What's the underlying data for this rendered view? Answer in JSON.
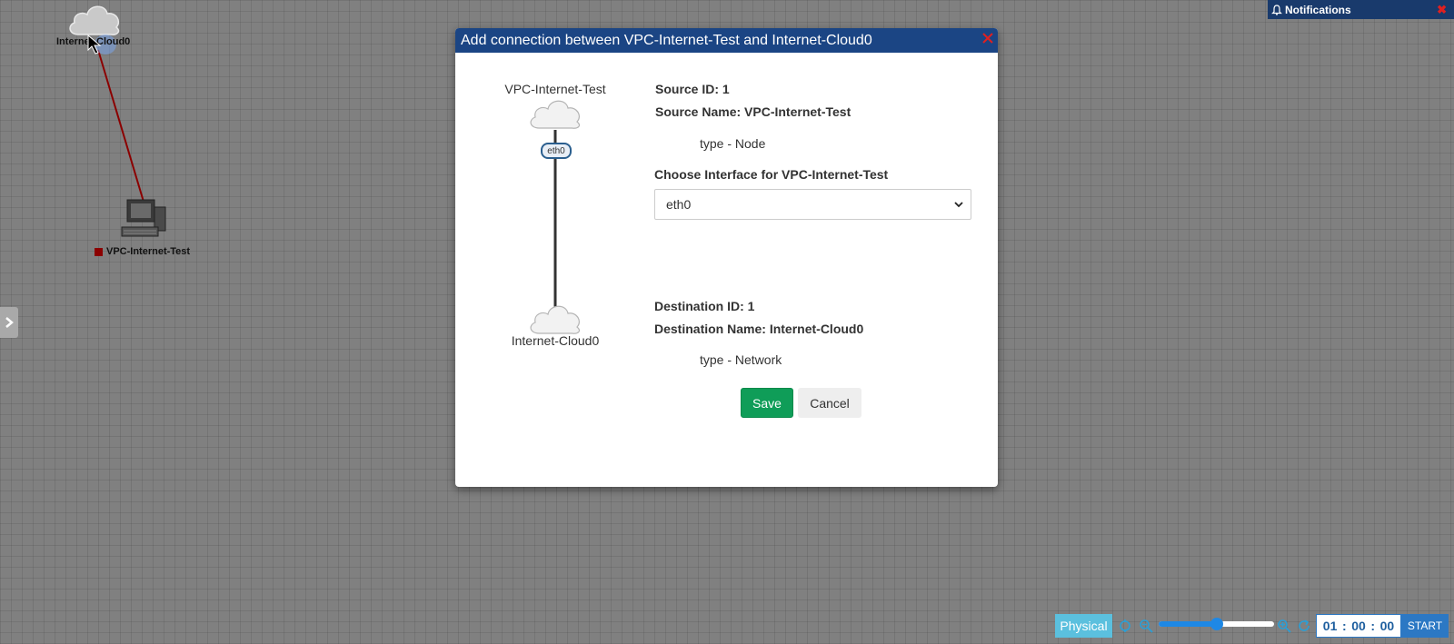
{
  "canvas": {
    "nodes": [
      {
        "label": "Internet-Cloud0",
        "icon": "cloud-icon"
      },
      {
        "label": "VPC-Internet-Test",
        "icon": "computer-icon",
        "status_color": "#8b0000"
      }
    ],
    "link_color": "#8b0000"
  },
  "notifications": {
    "title": "Notifications",
    "close_icon": "close-icon"
  },
  "modal": {
    "title": "Add connection between VPC-Internet-Test and Internet-Cloud0",
    "diagram": {
      "source_label": "VPC-Internet-Test",
      "interface_tag": "eth0",
      "destination_label": "Internet-Cloud0"
    },
    "source": {
      "id_label": "Source ID:",
      "id_value": "1",
      "name_label": "Source Name:",
      "name_value": "VPC-Internet-Test",
      "type_text": "type - Node",
      "interface_label": "Choose Interface for VPC-Internet-Test",
      "interface_selected": "eth0"
    },
    "destination": {
      "id_label": "Destination ID:",
      "id_value": "1",
      "name_label": "Destination Name:",
      "name_value": "Internet-Cloud0",
      "type_text": "type - Network"
    },
    "save_label": "Save",
    "cancel_label": "Cancel"
  },
  "toolbar": {
    "physical_label": "Physical",
    "zoom_level": 0.5,
    "timer": {
      "hours": "01",
      "minutes": "00",
      "seconds": "00",
      "sep": ":"
    },
    "start_label": "START"
  },
  "colors": {
    "header": "#1b4584",
    "save": "#0f9d58",
    "physical": "#5bc0de",
    "start": "#2c78c4"
  }
}
